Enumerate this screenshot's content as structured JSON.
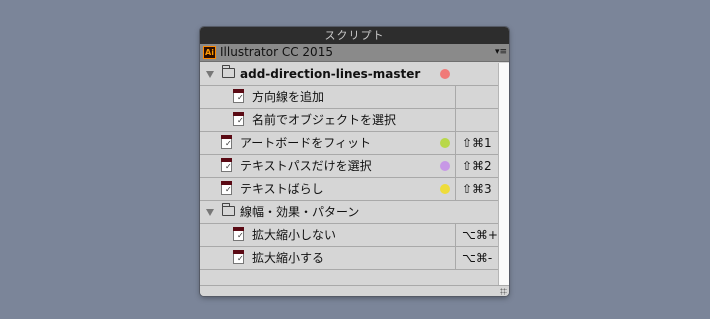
{
  "panel": {
    "title": "スクリプト",
    "app_label": "Illustrator CC 2015",
    "app_icon_text": "Ai",
    "menu_icon": "panel-menu-icon",
    "menu_glyph": "▾≡"
  },
  "rows": [
    {
      "type": "folder",
      "label": "add-direction-lines-master",
      "dot_color": "#f07a78"
    },
    {
      "type": "script",
      "label": "方向線を追加",
      "shortcut": ""
    },
    {
      "type": "script",
      "label": "名前でオブジェクトを選択",
      "shortcut": ""
    },
    {
      "type": "script",
      "label": "アートボードをフィット",
      "dot_color": "#b8d849",
      "shortcut": "⇧⌘1"
    },
    {
      "type": "script",
      "label": "テキストパスだけを選択",
      "dot_color": "#c798e6",
      "shortcut": "⇧⌘2"
    },
    {
      "type": "script",
      "label": "テキストばらし",
      "dot_color": "#eedc3a",
      "shortcut": "⇧⌘3"
    },
    {
      "type": "folder",
      "label": "線幅・効果・パターン"
    },
    {
      "type": "script",
      "label": "拡大縮小しない",
      "shortcut": "⌥⌘+"
    },
    {
      "type": "script",
      "label": "拡大縮小する",
      "shortcut": "⌥⌘-"
    }
  ]
}
